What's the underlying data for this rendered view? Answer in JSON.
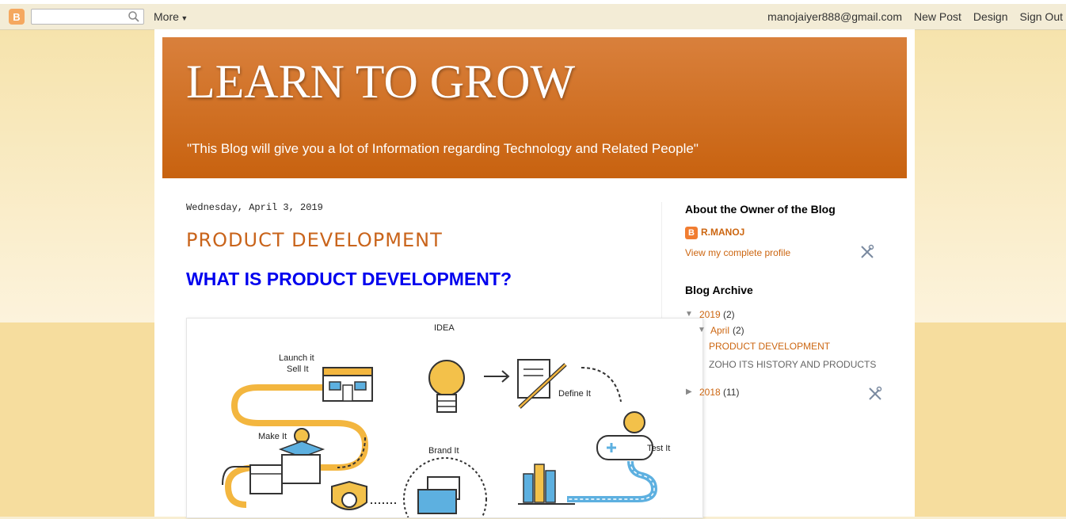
{
  "navbar": {
    "more_label": "More",
    "email": "manojaiyer888@gmail.com",
    "new_post": "New Post",
    "design": "Design",
    "sign_out": "Sign Out"
  },
  "header": {
    "title": "LEARN TO GROW",
    "description": "\"This Blog will give you a lot of Information regarding Technology and Related People\""
  },
  "post": {
    "date": "Wednesday, April 3, 2019",
    "title": "PRODUCT DEVELOPMENT",
    "heading": "WHAT IS PRODUCT DEVELOPMENT?",
    "diagram_labels": {
      "idea": "IDEA",
      "launch": "Launch it",
      "sell": "Sell It",
      "define": "Define It",
      "make": "Make It",
      "brand": "Brand It",
      "test": "Test It"
    }
  },
  "sidebar": {
    "about_heading": "About the Owner of the Blog",
    "owner_name": "R.MANOJ",
    "profile_link": "View my complete profile",
    "archive_heading": "Blog Archive",
    "years": [
      {
        "year": "2019",
        "count": "(2)"
      },
      {
        "year": "2018",
        "count": "(11)"
      }
    ],
    "month": {
      "name": "April",
      "count": "(2)"
    },
    "posts": [
      "PRODUCT DEVELOPMENT",
      "ZOHO ITS HISTORY AND PRODUCTS"
    ]
  },
  "colors": {
    "header_gradient_top": "#d9803c",
    "header_gradient_bottom": "#c8620f",
    "link_orange": "#cc6611",
    "heading_blue": "#0000ee",
    "post_title_orange": "#c9641b"
  }
}
